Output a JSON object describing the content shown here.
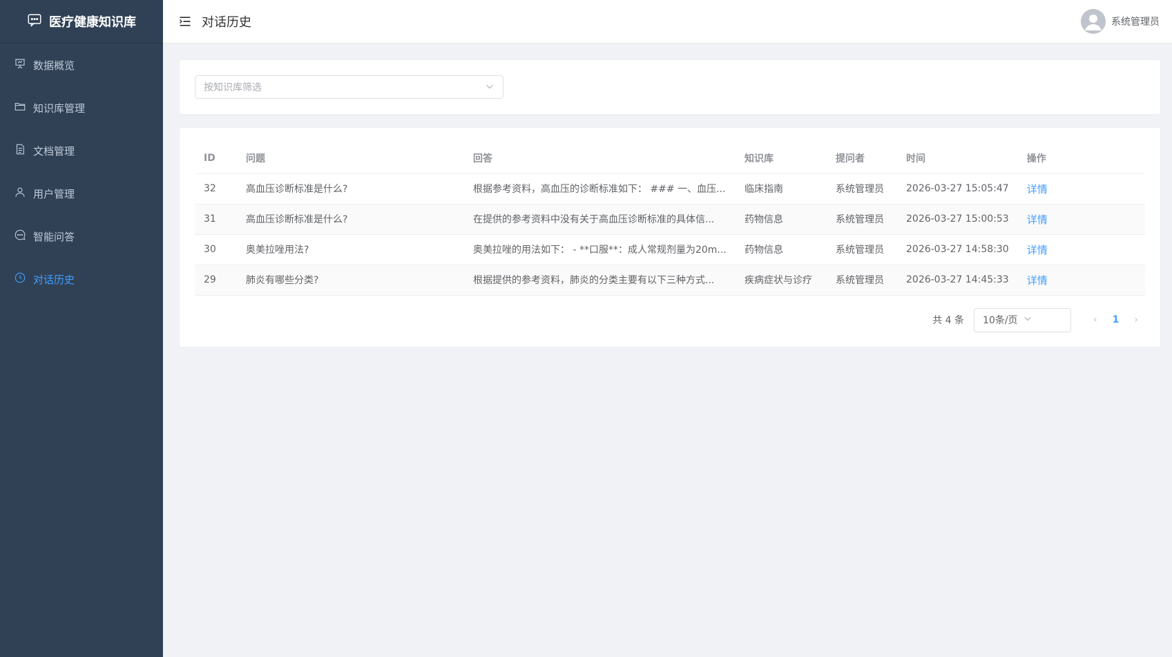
{
  "brand": {
    "title": "医疗健康知识库"
  },
  "sidebar": {
    "items": [
      {
        "label": "数据概览",
        "icon": "presentation-chart-icon",
        "active": false
      },
      {
        "label": "知识库管理",
        "icon": "folder-icon",
        "active": false
      },
      {
        "label": "文档管理",
        "icon": "document-icon",
        "active": false
      },
      {
        "label": "用户管理",
        "icon": "user-icon",
        "active": false
      },
      {
        "label": "智能问答",
        "icon": "chat-bubble-icon",
        "active": false
      },
      {
        "label": "对话历史",
        "icon": "clock-icon",
        "active": true
      }
    ]
  },
  "header": {
    "title": "对话历史",
    "username": "系统管理员"
  },
  "filter": {
    "placeholder": "按知识库筛选"
  },
  "table": {
    "columns": [
      "ID",
      "问题",
      "回答",
      "知识库",
      "提问者",
      "时间",
      "操作"
    ],
    "rows": [
      {
        "id": "32",
        "question": "高血压诊断标准是什么?",
        "answer": "根据参考资料，高血压的诊断标准如下： ### 一、血压...",
        "kb": "临床指南",
        "asker": "系统管理员",
        "time": "2026-03-27 15:05:47",
        "action": "详情"
      },
      {
        "id": "31",
        "question": "高血压诊断标准是什么?",
        "answer": "在提供的参考资料中没有关于高血压诊断标准的具体信...",
        "kb": "药物信息",
        "asker": "系统管理员",
        "time": "2026-03-27 15:00:53",
        "action": "详情"
      },
      {
        "id": "30",
        "question": "奥美拉唑用法?",
        "answer": "奥美拉唑的用法如下： - **口服**：成人常规剂量为20m...",
        "kb": "药物信息",
        "asker": "系统管理员",
        "time": "2026-03-27 14:58:30",
        "action": "详情"
      },
      {
        "id": "29",
        "question": "肺炎有哪些分类?",
        "answer": "根据提供的参考资料，肺炎的分类主要有以下三种方式...",
        "kb": "疾病症状与诊疗",
        "asker": "系统管理员",
        "time": "2026-03-27 14:45:33",
        "action": "详情"
      }
    ]
  },
  "pagination": {
    "total": "共 4 条",
    "page_size": "10条/页",
    "current_page": "1",
    "prev": "‹",
    "next": "›"
  },
  "colors": {
    "sidebar_bg": "#304156",
    "accent": "#409eff",
    "page_bg": "#f0f2f5"
  }
}
